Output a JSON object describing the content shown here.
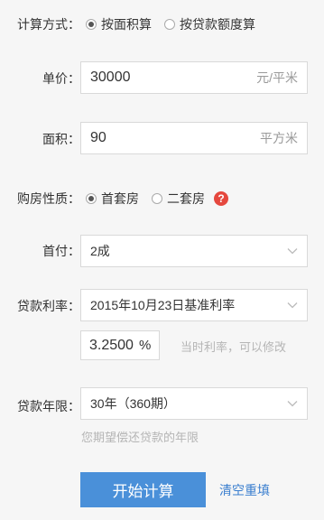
{
  "calc_method": {
    "label": "计算方式：",
    "options": [
      "按面积算",
      "按贷款额度算"
    ],
    "selected": 0
  },
  "unit_price": {
    "label": "单价：",
    "value": "30000",
    "unit": "元/平米"
  },
  "area": {
    "label": "面积：",
    "value": "90",
    "unit": "平方米"
  },
  "house_type": {
    "label": "购房性质：",
    "options": [
      "首套房",
      "二套房"
    ],
    "selected": 0,
    "help_glyph": "?"
  },
  "down_payment": {
    "label": "首付：",
    "value": "2成"
  },
  "loan_rate": {
    "label": "贷款利率：",
    "value": "2015年10月23日基准利率",
    "rate_value": "3.2500",
    "rate_unit": "%",
    "hint": "当时利率，可以修改"
  },
  "loan_term": {
    "label": "贷款年限：",
    "value": "30年（360期）",
    "hint": "您期望偿还贷款的年限"
  },
  "actions": {
    "calculate": "开始计算",
    "reset": "清空重填"
  },
  "colors": {
    "primary": "#4a90d9",
    "link": "#3b7fcf",
    "help": "#e5483e",
    "background": "#f6f6f6"
  }
}
